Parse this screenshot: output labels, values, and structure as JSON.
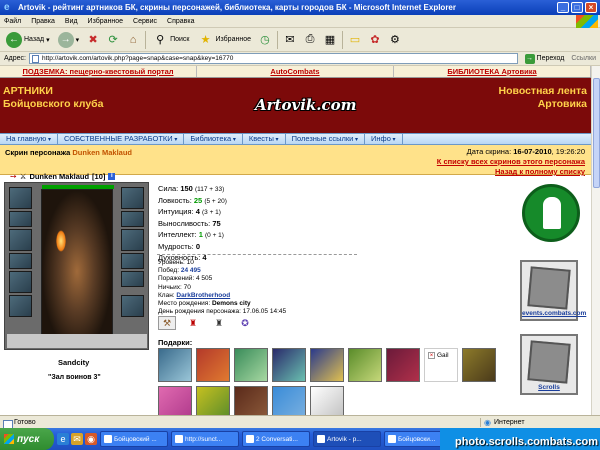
{
  "window": {
    "title": "Artovik - рейтинг артников БК, скрины персонажей, библиотека, карты городов БК - Microsoft Internet Explorer",
    "icon": "ie-icon"
  },
  "menubar": [
    "Файл",
    "Правка",
    "Вид",
    "Избранное",
    "Сервис",
    "Справка"
  ],
  "toolbar": {
    "back_label": "Назад",
    "search_label": "Поиск",
    "favorites_label": "Избранное"
  },
  "address": {
    "label": "Адрес:",
    "url": "http://artovik.com/artovik.php?page=snap&case=snap&key=16770",
    "go_label": "Переход",
    "links_label": "Ссылки"
  },
  "site": {
    "top_links": [
      "ПОДЗЕМКА: пещерно-квестовый портал",
      "AutoCombats",
      "БИБЛИОТЕКА Артовика"
    ],
    "header_left": [
      "АРТНИКИ",
      "Бойцовского клуба"
    ],
    "header_right": [
      "Новостная лента",
      "Артовика"
    ],
    "logo": "Artovik.com",
    "nav": [
      "На главную",
      "СОБСТВЕННЫЕ РАЗРАБОТКИ",
      "Библиотека",
      "Квесты",
      "Полезные ссылки",
      "Инфо"
    ]
  },
  "info": {
    "skin_prefix": "Скрин персонажа",
    "skin_name": "Dunken Maklaud",
    "date_label": "Дата скрина:",
    "date_value": "16-07-2010",
    "time_value": ", 19:26:20",
    "all_skins_link": "К списку всех скринов этого персонажа",
    "back_link": "Назад к полному списку"
  },
  "character": {
    "name": "Dunken Maklaud",
    "level": "[10]",
    "location": "Sandcity",
    "hall": "\"Зал воинов 3\"",
    "hp_fraction": 1.0
  },
  "stats": [
    {
      "label": "Сила:",
      "value": "150",
      "extra": "(117 + 33)",
      "style": "bold"
    },
    {
      "label": "Ловкость:",
      "value": "25",
      "extra": "(5 + 20)",
      "style": "green"
    },
    {
      "label": "Интуиция:",
      "value": "4",
      "extra": "(3 + 1)",
      "style": "bold"
    },
    {
      "label": "Выносливость:",
      "value": "75",
      "extra": "",
      "style": "bold"
    },
    {
      "label": "Интеллект:",
      "value": "1",
      "extra": "(0 + 1)",
      "style": "green"
    },
    {
      "label": "Мудрость:",
      "value": "0",
      "extra": "",
      "style": "bold"
    },
    {
      "label": "Духовность:",
      "value": "4",
      "extra": "",
      "style": "bold"
    }
  ],
  "details": {
    "level_label": "Уровень:",
    "level_value": "10",
    "wins_label": "Побед:",
    "wins_value": "24 495",
    "losses_label": "Поражений:",
    "losses_value": "4 505",
    "draws_label": "Ничьих:",
    "draws_value": "70",
    "clan_label": "Клан:",
    "clan_value": "DarkBrotherhood",
    "birthplace_label": "Место рождения:",
    "birthplace_value": "Demons city",
    "birthday_label": "День рождения персонажа:",
    "birthday_value": "17.06.05 14:45"
  },
  "gifts": {
    "label": "Подарки:",
    "broken_gift_text": "Gail"
  },
  "side": {
    "events_caption": "events.combats.com",
    "scrolls_caption": "Scrolls"
  },
  "statusbar": {
    "left": "Готово",
    "zone": "Интернет"
  },
  "taskbar": {
    "start_label": "пуск",
    "tasks": [
      "Бойцовский ...",
      "http://sunct...",
      "2 Conversati...",
      "Artovik - р...",
      "Бойцовски..."
    ],
    "watermark": "photo.scrolls.combats.com"
  }
}
